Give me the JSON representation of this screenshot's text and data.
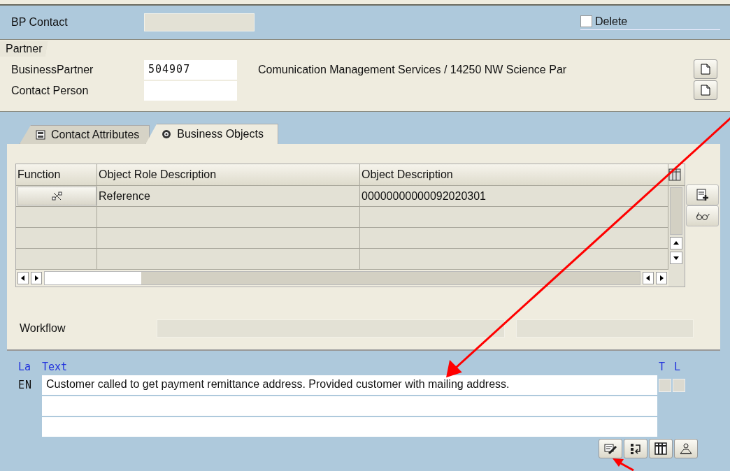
{
  "header": {
    "bp_contact_label": "BP Contact",
    "delete": {
      "label": "Delete",
      "checked": false
    }
  },
  "partner": {
    "title": "Partner",
    "fields": [
      {
        "label": "BusinessPartner",
        "value": "504907",
        "description": "Comunication Management Services / 14250 NW Science Par"
      },
      {
        "label": "Contact Person"
      }
    ]
  },
  "tabs": [
    {
      "label": "Contact Attributes",
      "selected": false
    },
    {
      "label": "Business Objects",
      "selected": true
    }
  ],
  "table": {
    "columns": [
      "Function",
      "Object Role Description",
      "Object Description"
    ],
    "rows": [
      {
        "role": "Reference",
        "object": "00000000000092020301"
      }
    ]
  },
  "workflow": {
    "label": "Workflow"
  },
  "texts": {
    "columns": [
      "La",
      "Text",
      "T",
      "L"
    ],
    "lines": [
      {
        "language": "EN",
        "text": "Customer called to get payment remittance address. Provided customer with mailing address.",
        "t": false,
        "l": false
      }
    ]
  }
}
